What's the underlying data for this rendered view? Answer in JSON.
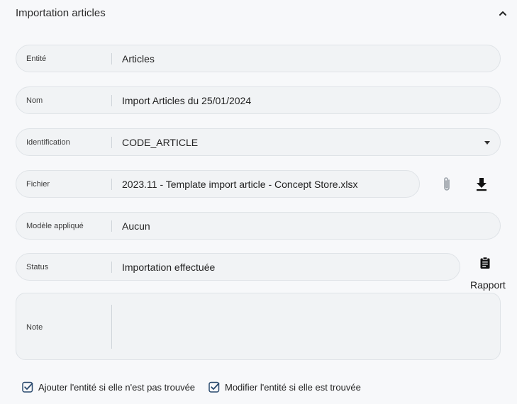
{
  "header": {
    "title": "Importation articles"
  },
  "fields": {
    "entite": {
      "label": "Entité",
      "value": "Articles"
    },
    "nom": {
      "label": "Nom",
      "value": "Import Articles du 25/01/2024"
    },
    "identification": {
      "label": "Identification",
      "value": "CODE_ARTICLE"
    },
    "fichier": {
      "label": "Fichier",
      "value": "2023.11 - Template import article - Concept Store.xlsx"
    },
    "modele": {
      "label": "Modèle appliqué",
      "value": "Aucun"
    },
    "status": {
      "label": "Status",
      "value": "Importation effectuée"
    },
    "note": {
      "label": "Note",
      "value": ""
    }
  },
  "actions": {
    "rapport_label": "Rapport"
  },
  "options": {
    "ajouter": {
      "label": "Ajouter l'entité si elle n'est pas trouvée",
      "checked": true
    },
    "modifier": {
      "label": "Modifier l'entité si elle est trouvée",
      "checked": true
    }
  },
  "colors": {
    "accent": "#2a4a6e",
    "field_bg": "#f1f3f5",
    "field_border": "#dfe3e7",
    "page_bg": "#f7f8fa"
  },
  "icons": {
    "collapse": "chevron-up-icon",
    "attach": "paperclip-icon",
    "download": "download-icon",
    "report": "clipboard-icon",
    "checkbox": "checkbox-checked-icon"
  }
}
